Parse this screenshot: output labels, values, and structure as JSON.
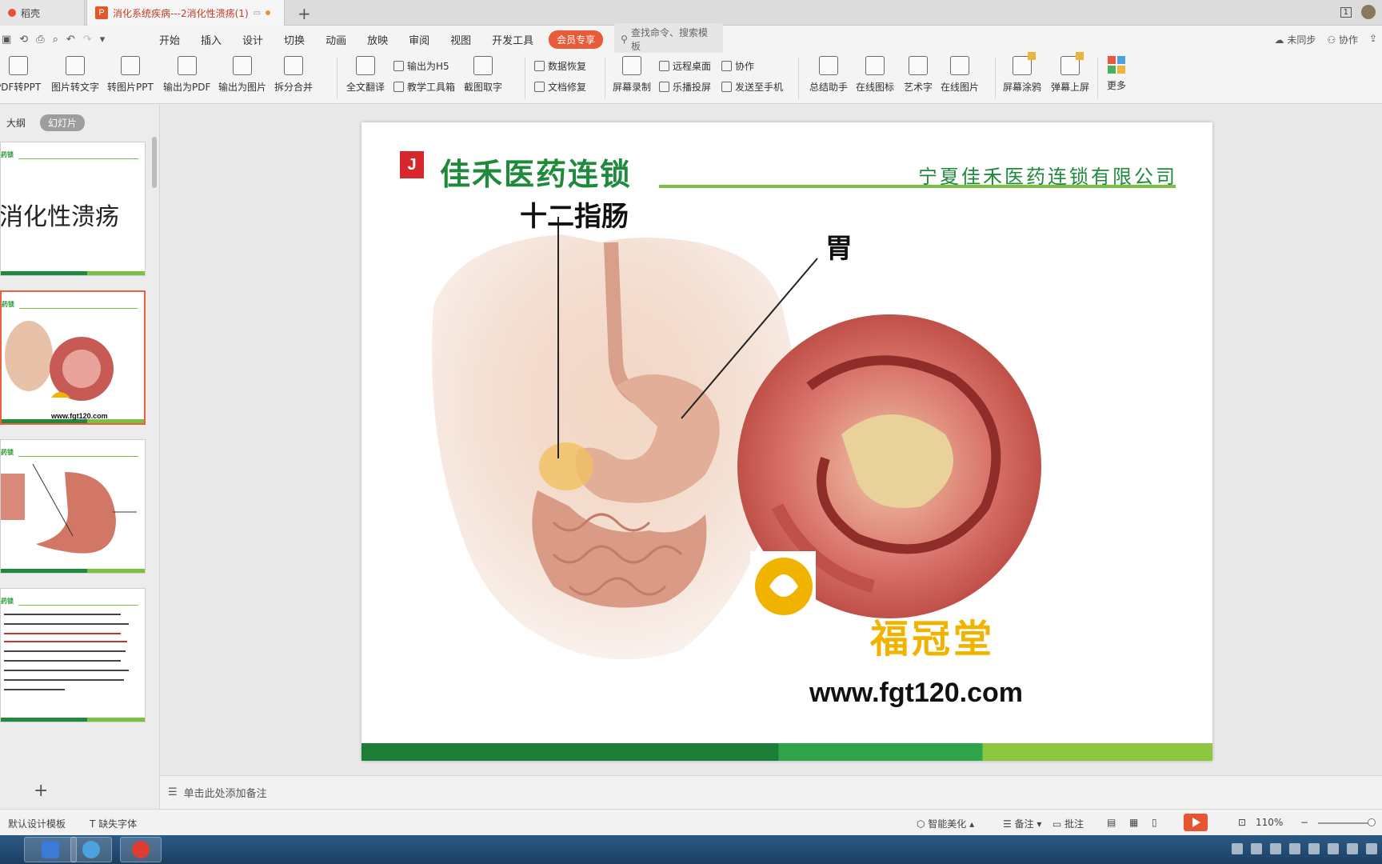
{
  "tabs": {
    "home_label": "稻壳",
    "doc_label": "消化系统疾病---2消化性溃疡(1)",
    "page_indicator": "1"
  },
  "menu": {
    "items": [
      "开始",
      "插入",
      "设计",
      "切换",
      "动画",
      "放映",
      "审阅",
      "视图",
      "开发工具"
    ],
    "vip_label": "会员专享",
    "search_placeholder": "查找命令、搜索模板",
    "sync_label": "未同步",
    "collab_label": "协作"
  },
  "ribbon": {
    "pdf_to_ppt": "PDF转PPT",
    "image_to_text": "图片转文字",
    "image_to_ppt": "转图片PPT",
    "export_pdf": "输出为PDF",
    "export_image": "输出为图片",
    "split_merge": "拆分合并",
    "full_translate": "全文翻译",
    "export_h5": "输出为H5",
    "teaching_toolbox": "教学工具箱",
    "screenshot_text": "截图取字",
    "data_recovery": "数据恢复",
    "doc_repair": "文档修复",
    "screen_record": "屏幕录制",
    "remote_desktop": "远程桌面",
    "cast_screen": "乐播投屏",
    "collaborate": "协作",
    "send_phone": "发送至手机",
    "summary_assistant": "总结助手",
    "online_icons": "在线图标",
    "art_text": "艺术字",
    "online_images": "在线图片",
    "screen_doodle": "屏幕涂鸦",
    "bullet_screen": "弹幕上屏",
    "more": "更多"
  },
  "left_panel": {
    "tab_outline": "大纲",
    "tab_slides": "幻灯片",
    "thumb1_text": "消化性溃疡",
    "thumb2_url": "www.fgt120.com"
  },
  "slide": {
    "brand": "佳禾医药连锁",
    "company": "宁夏佳禾医药连锁有限公司",
    "label_duodenum": "十二指肠",
    "label_stomach": "胃",
    "watermark_text": "福冠堂",
    "url": "www.fgt120.com"
  },
  "notes": {
    "placeholder": "单击此处添加备注"
  },
  "status": {
    "template": "默认设计模板",
    "missing_fonts": "缺失字体",
    "smart_beautify": "智能美化",
    "notes_label": "备注",
    "comment_label": "批注",
    "zoom": "110%"
  },
  "colors": {
    "brand_green": "#1f8a3c",
    "light_green": "#7ac143",
    "accent_orange": "#e8542f",
    "watermark_gold": "#f0b400"
  }
}
